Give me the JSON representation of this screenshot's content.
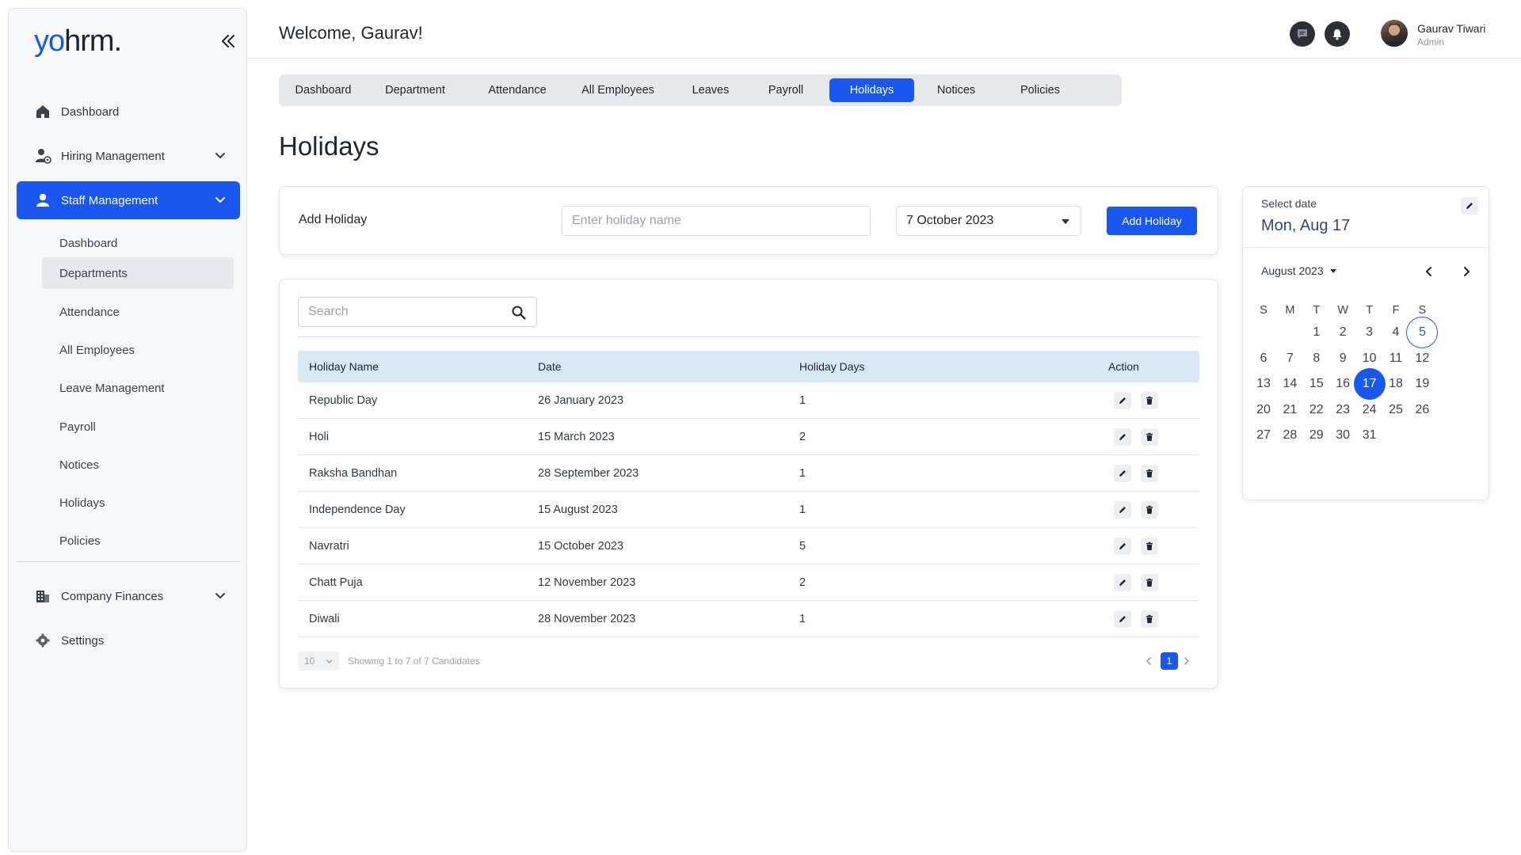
{
  "brand": {
    "logo_prefix": "yo",
    "logo_suffix": "hrm."
  },
  "sidebar": {
    "items": [
      {
        "label": "Dashboard",
        "icon": "home-icon"
      },
      {
        "label": "Hiring Management",
        "icon": "hiring-icon"
      },
      {
        "label": "Staff Management",
        "icon": "staff-icon",
        "active": true
      },
      {
        "label": "Company Finances",
        "icon": "building-icon"
      },
      {
        "label": "Settings",
        "icon": "gear-icon"
      }
    ],
    "staff_sub": [
      "Dashboard",
      "Departments",
      "Attendance",
      "All Employees",
      "Leave Management",
      "Payroll",
      "Notices",
      "Holidays",
      "Policies"
    ],
    "selected_sub": "Departments"
  },
  "header": {
    "welcome": "Welcome,  Gaurav!",
    "user_name": "Gaurav Tiwari",
    "user_role": "Admin"
  },
  "tabs": [
    "Dashboard",
    "Department",
    "Attendance",
    "All Employees",
    "Leaves",
    "Payroll",
    "Holidays",
    "Notices",
    "Policies"
  ],
  "active_tab": "Holidays",
  "page_title": "Holidays",
  "add_holiday": {
    "label": "Add Holiday",
    "name_placeholder": "Enter holiday name",
    "date_value": "7 October 2023",
    "button": "Add Holiday"
  },
  "table": {
    "search_placeholder": "Search",
    "columns": [
      "Holiday Name",
      "Date",
      "Holiday Days",
      "Action"
    ],
    "rows": [
      [
        "Republic Day",
        "26 January 2023",
        "1"
      ],
      [
        "Holi",
        "15 March 2023",
        "2"
      ],
      [
        "Raksha Bandhan",
        "28 September 2023",
        "1"
      ],
      [
        "Independence Day",
        "15 August 2023",
        "1"
      ],
      [
        "Navratri",
        "15 October 2023",
        "5"
      ],
      [
        "Chatt Puja",
        "12 November 2023",
        "2"
      ],
      [
        "Diwali",
        "28 November 2023",
        "1"
      ]
    ],
    "per_page": "10",
    "showing": "Showing 1 to 7 of 7 Candidates",
    "current_page": "1"
  },
  "calendar": {
    "select_label": "Select date",
    "selected_label": "Mon, Aug 17",
    "month_label": "August 2023",
    "weekdays": [
      "S",
      "M",
      "T",
      "W",
      "T",
      "F",
      "S"
    ],
    "first_weekday_index": 2,
    "days_in_month": 31,
    "today": 5,
    "selected": 17
  },
  "colors": {
    "accent": "#1a56f0",
    "table_header": "#d8e9f6",
    "sidebar_bg": "#f7f8fa"
  }
}
